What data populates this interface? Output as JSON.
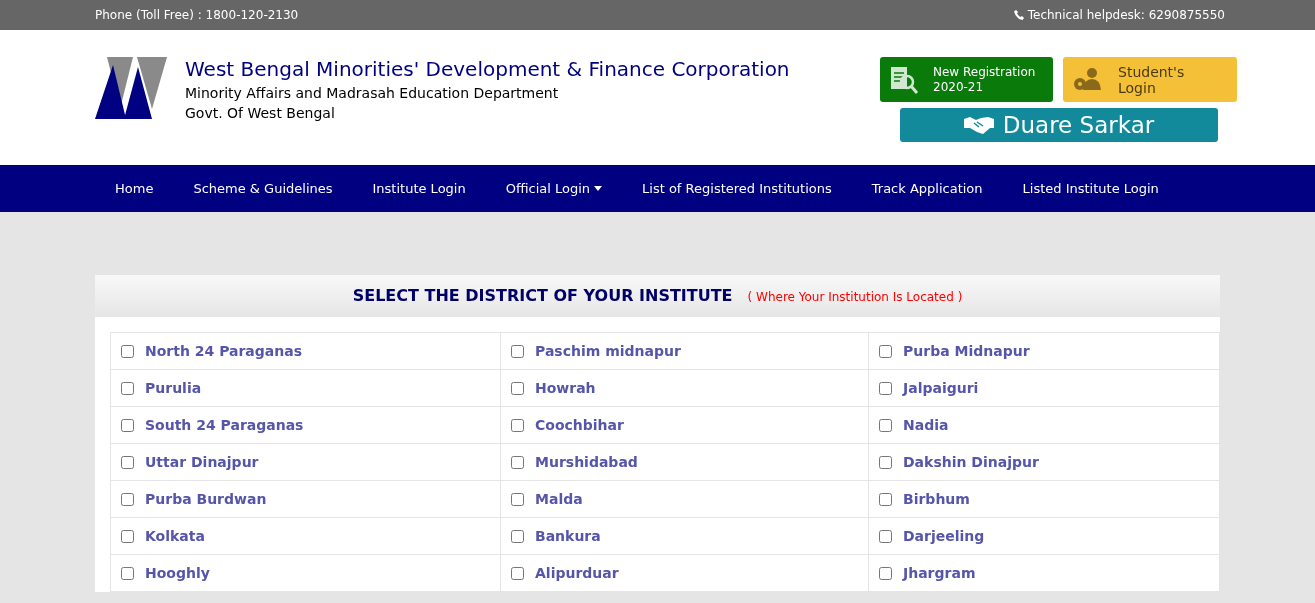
{
  "top_bar": {
    "phone": "Phone (Toll Free) : 1800-120-2130",
    "helpdesk": "Technical helpdesk: 6290875550"
  },
  "header": {
    "title": "West Bengal Minorities' Development & Finance Corporation",
    "subtitle": "Minority Affairs and Madrasah Education Department",
    "govt": "Govt. Of West Bengal"
  },
  "buttons": {
    "registration": [
      "New Registration",
      "2020-21"
    ],
    "student_login": [
      "Student's",
      "Login"
    ],
    "duare_sarkar": "Duare Sarkar"
  },
  "nav": [
    {
      "label": "Home",
      "dropdown": false
    },
    {
      "label": "Scheme & Guidelines",
      "dropdown": false
    },
    {
      "label": "Institute Login",
      "dropdown": false
    },
    {
      "label": "Official Login",
      "dropdown": true
    },
    {
      "label": "List of Registered Institutions",
      "dropdown": false
    },
    {
      "label": "Track Application",
      "dropdown": false
    },
    {
      "label": "Listed Institute Login",
      "dropdown": false
    }
  ],
  "district_panel": {
    "title": "SELECT THE DISTRICT OF YOUR INSTITUTE",
    "note": "( Where Your Institution Is Located )",
    "rows": [
      [
        {
          "label": "North 24 Paraganas",
          "checked": false
        },
        {
          "label": "Paschim midnapur",
          "checked": false
        },
        {
          "label": "Purba Midnapur",
          "checked": false
        }
      ],
      [
        {
          "label": "Purulia",
          "checked": false
        },
        {
          "label": "Howrah",
          "checked": false
        },
        {
          "label": "Jalpaiguri",
          "checked": false
        }
      ],
      [
        {
          "label": "South 24 Paraganas",
          "checked": false
        },
        {
          "label": "Coochbihar",
          "checked": false
        },
        {
          "label": "Nadia",
          "checked": false
        }
      ],
      [
        {
          "label": "Uttar Dinajpur",
          "checked": false
        },
        {
          "label": "Murshidabad",
          "checked": false
        },
        {
          "label": "Dakshin Dinajpur",
          "checked": false
        }
      ],
      [
        {
          "label": "Purba Burdwan",
          "checked": false
        },
        {
          "label": "Malda",
          "checked": false
        },
        {
          "label": "Birbhum",
          "checked": false
        }
      ],
      [
        {
          "label": "Kolkata",
          "checked": false
        },
        {
          "label": "Bankura",
          "checked": false
        },
        {
          "label": "Darjeeling",
          "checked": false
        }
      ],
      [
        {
          "label": "Hooghly",
          "checked": false
        },
        {
          "label": "Alipurduar",
          "checked": false
        },
        {
          "label": "Jhargram",
          "checked": false
        }
      ]
    ]
  }
}
